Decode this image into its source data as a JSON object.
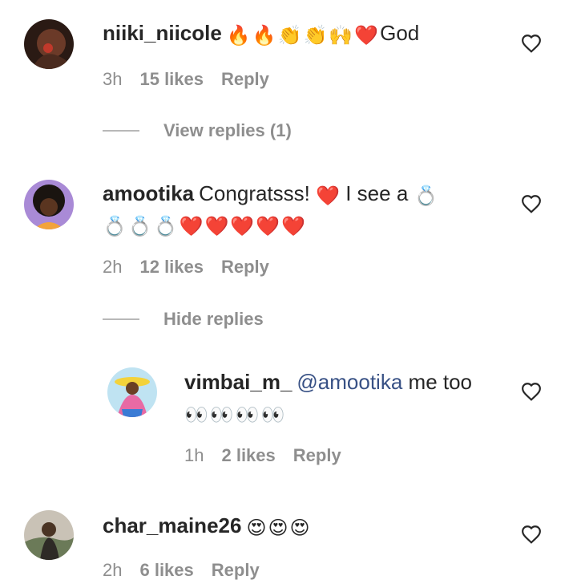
{
  "comments": [
    {
      "username": "niiki_niicole",
      "body_emoji": "🔥🔥👏👏🙌❤️",
      "body_text": "God",
      "time": "3h",
      "likes": "15 likes",
      "reply": "Reply",
      "replies_toggle": "View replies (1)"
    },
    {
      "username": "amootika",
      "body_text_1": "Congratsss! ",
      "body_emoji_1": "❤️",
      "body_text_2": " I see a ",
      "body_emoji_2": "💍",
      "body_line2": "💍💍💍❤️❤️❤️❤️❤️",
      "time": "2h",
      "likes": "12 likes",
      "reply": "Reply",
      "replies_toggle": "Hide replies"
    },
    {
      "username": "vimbai_m_",
      "mention": "@amootika",
      "body_text": " me too",
      "body_line2": "👀👀👀👀",
      "time": "1h",
      "likes": "2 likes",
      "reply": "Reply"
    },
    {
      "username": "char_maine26",
      "body_emoji": "😍😍😍",
      "time": "2h",
      "likes": "6 likes",
      "reply": "Reply"
    }
  ],
  "colors": {
    "text": "#262626",
    "meta": "#8e8e8e",
    "mention": "#385185"
  },
  "icons": {
    "like": "heart-outline-icon"
  }
}
